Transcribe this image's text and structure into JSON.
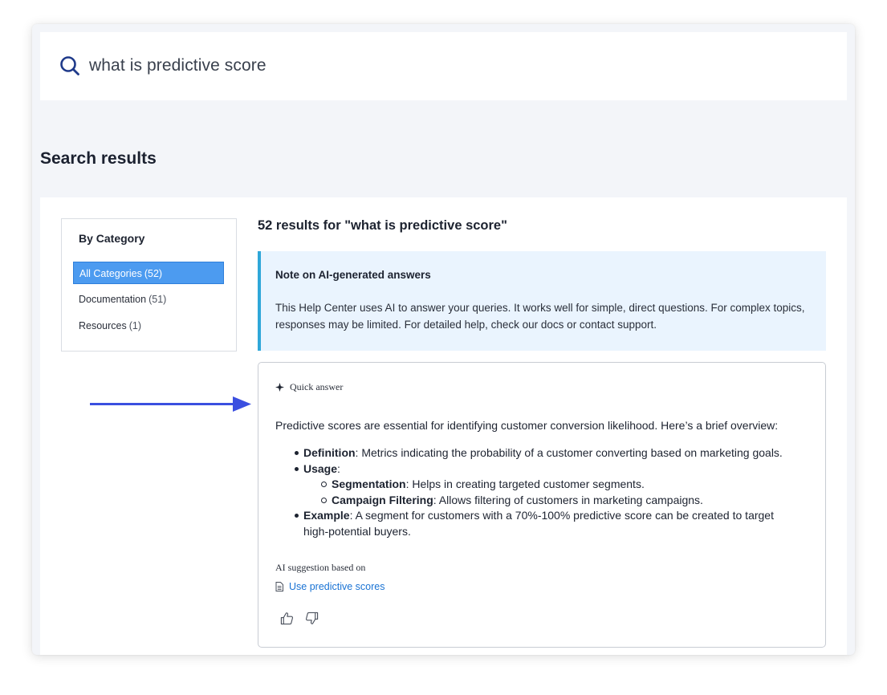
{
  "search": {
    "query": "what is predictive score",
    "icon": "search-icon"
  },
  "page": {
    "heading": "Search results"
  },
  "categories": {
    "title": "By Category",
    "items": [
      {
        "label": "All Categories",
        "count": "(52)",
        "active": true
      },
      {
        "label": "Documentation",
        "count": "(51)",
        "active": false
      },
      {
        "label": "Resources",
        "count": "(1)",
        "active": false
      }
    ]
  },
  "results": {
    "count_label": "52 results for \"what is predictive score\""
  },
  "note": {
    "title": "Note on AI-generated answers",
    "body": "This Help Center uses AI to answer your queries. It works well for simple, direct questions. For complex topics, responses may be limited. For detailed help, check our docs or contact support."
  },
  "quick_answer": {
    "label": "Quick answer",
    "intro": "Predictive scores are essential for identifying customer conversion likelihood. Here’s a brief overview:",
    "bullets": [
      {
        "term": "Definition",
        "text": ": Metrics indicating the probability of a customer converting based on marketing goals."
      },
      {
        "term": "Usage",
        "text": ":"
      },
      {
        "term": "Example",
        "text": ": A segment for customers with a 70%-100% predictive score can be created to target high-potential buyers."
      }
    ],
    "sub_bullets": [
      {
        "term": "Segmentation",
        "text": ": Helps in creating targeted customer segments."
      },
      {
        "term": "Campaign Filtering",
        "text": ": Allows filtering of customers in marketing campaigns."
      }
    ],
    "source_intro": "AI suggestion based on",
    "source_link": "Use predictive scores"
  },
  "colors": {
    "accent": "#4c9bf0",
    "link": "#1a73d4",
    "note_bg": "#eaf4fe",
    "note_border": "#2fa7d9",
    "arrow": "#3b4fe0",
    "search_icon": "#1f3a8a"
  }
}
